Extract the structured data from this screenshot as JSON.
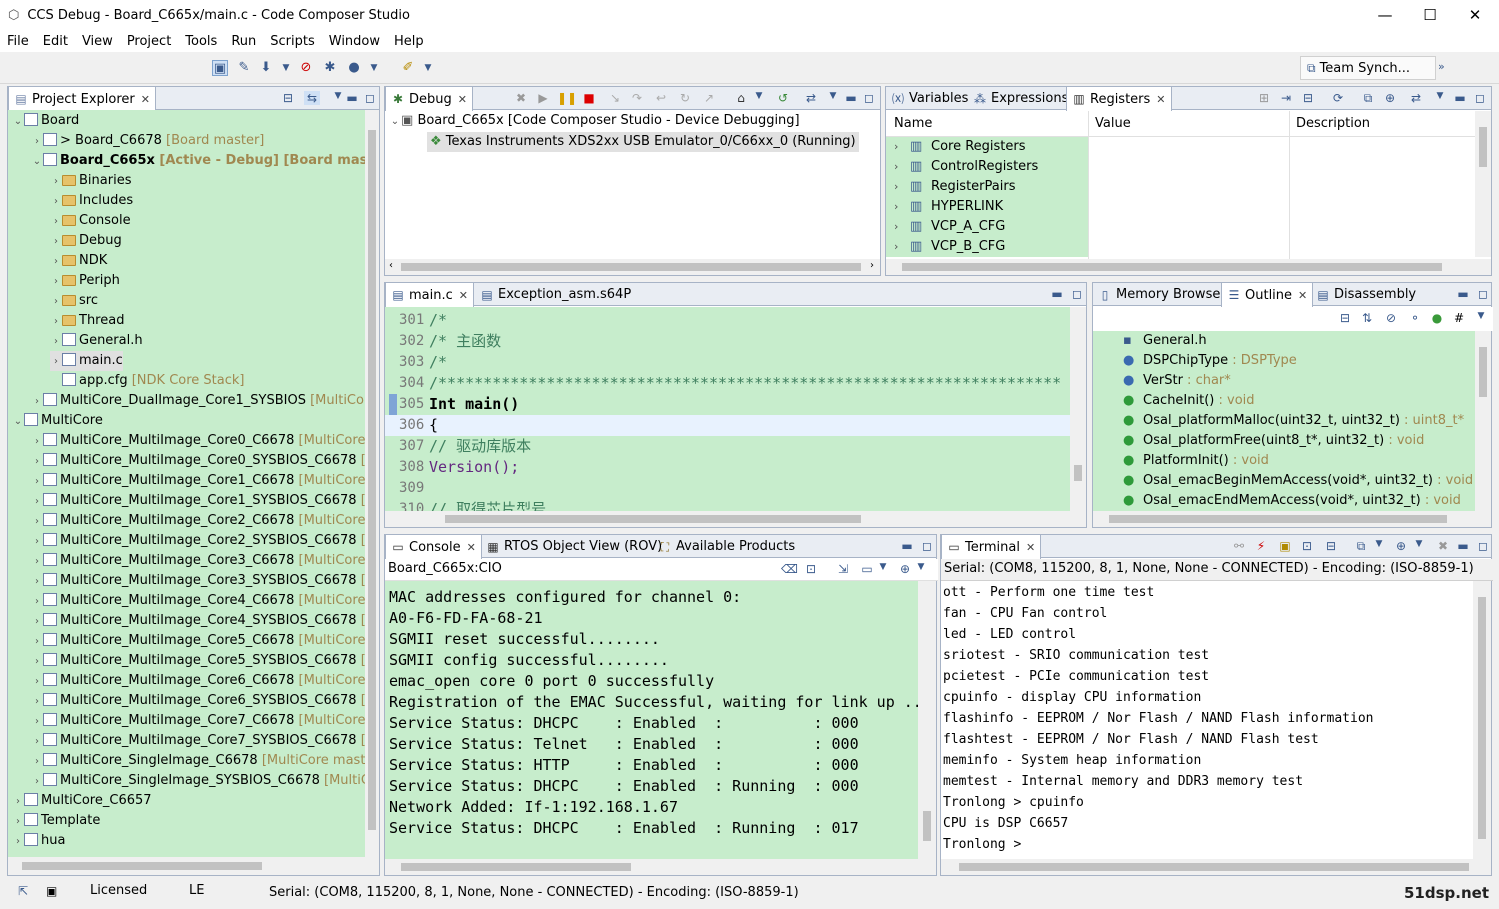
{
  "window": {
    "title": "CCS Debug - Board_C665x/main.c - Code Composer Studio"
  },
  "menu": [
    "File",
    "Edit",
    "View",
    "Project",
    "Tools",
    "Run",
    "Scripts",
    "Window",
    "Help"
  ],
  "team_sync": "Team Synch...",
  "project_explorer": {
    "tab": "Project Explorer",
    "items": [
      {
        "lvl": 0,
        "label": "Board",
        "exp": true
      },
      {
        "lvl": 1,
        "label": "> Board_C6678",
        "dec": " [Board master]",
        "exp": false
      },
      {
        "lvl": 1,
        "label": "Board_C665x",
        "dec": " [Active - Debug] [Board master]",
        "exp": true,
        "bold": true
      },
      {
        "lvl": 2,
        "label": "Binaries",
        "exp": false
      },
      {
        "lvl": 2,
        "label": "Includes",
        "exp": false
      },
      {
        "lvl": 2,
        "label": "Console",
        "exp": false
      },
      {
        "lvl": 2,
        "label": "Debug",
        "exp": false
      },
      {
        "lvl": 2,
        "label": "NDK",
        "exp": false
      },
      {
        "lvl": 2,
        "label": "Periph",
        "exp": false
      },
      {
        "lvl": 2,
        "label": "src",
        "exp": false
      },
      {
        "lvl": 2,
        "label": "Thread",
        "exp": false
      },
      {
        "lvl": 2,
        "label": "General.h",
        "exp": false
      },
      {
        "lvl": 2,
        "label": "main.c",
        "exp": false,
        "sel": true
      },
      {
        "lvl": 2,
        "label": "app.cfg",
        "dec": " [NDK Core Stack]",
        "leaf": true
      },
      {
        "lvl": 1,
        "label": "MultiCore_DualImage_Core1_SYSBIOS",
        "dec": " [MultiCore m",
        "exp": false
      },
      {
        "lvl": 0,
        "label": "MultiCore",
        "exp": true
      },
      {
        "lvl": 1,
        "label": "MultiCore_MultiImage_Core0_C6678",
        "dec": " [MultiCore ma",
        "exp": false
      },
      {
        "lvl": 1,
        "label": "MultiCore_MultiImage_Core0_SYSBIOS_C6678",
        "dec": " [Mu",
        "exp": false
      },
      {
        "lvl": 1,
        "label": "MultiCore_MultiImage_Core1_C6678",
        "dec": " [MultiCore ma",
        "exp": false
      },
      {
        "lvl": 1,
        "label": "MultiCore_MultiImage_Core1_SYSBIOS_C6678",
        "dec": " [Mu",
        "exp": false
      },
      {
        "lvl": 1,
        "label": "MultiCore_MultiImage_Core2_C6678",
        "dec": " [MultiCore ma",
        "exp": false
      },
      {
        "lvl": 1,
        "label": "MultiCore_MultiImage_Core2_SYSBIOS_C6678",
        "dec": " [Mu",
        "exp": false
      },
      {
        "lvl": 1,
        "label": "MultiCore_MultiImage_Core3_C6678",
        "dec": " [MultiCore ma",
        "exp": false
      },
      {
        "lvl": 1,
        "label": "MultiCore_MultiImage_Core3_SYSBIOS_C6678",
        "dec": " [Mu",
        "exp": false
      },
      {
        "lvl": 1,
        "label": "MultiCore_MultiImage_Core4_C6678",
        "dec": " [MultiCore ma",
        "exp": false
      },
      {
        "lvl": 1,
        "label": "MultiCore_MultiImage_Core4_SYSBIOS_C6678",
        "dec": " [Mu",
        "exp": false
      },
      {
        "lvl": 1,
        "label": "MultiCore_MultiImage_Core5_C6678",
        "dec": " [MultiCore ma",
        "exp": false
      },
      {
        "lvl": 1,
        "label": "MultiCore_MultiImage_Core5_SYSBIOS_C6678",
        "dec": " [Mu",
        "exp": false
      },
      {
        "lvl": 1,
        "label": "MultiCore_MultiImage_Core6_C6678",
        "dec": " [MultiCore ma",
        "exp": false
      },
      {
        "lvl": 1,
        "label": "MultiCore_MultiImage_Core6_SYSBIOS_C6678",
        "dec": " [Mu",
        "exp": false
      },
      {
        "lvl": 1,
        "label": "MultiCore_MultiImage_Core7_C6678",
        "dec": " [MultiCore ma",
        "exp": false
      },
      {
        "lvl": 1,
        "label": "MultiCore_MultiImage_Core7_SYSBIOS_C6678",
        "dec": " [Mu",
        "exp": false
      },
      {
        "lvl": 1,
        "label": "MultiCore_SingleImage_C6678",
        "dec": " [MultiCore master]",
        "exp": false
      },
      {
        "lvl": 1,
        "label": "MultiCore_SingleImage_SYSBIOS_C6678",
        "dec": " [MultiCore",
        "exp": false
      },
      {
        "lvl": 0,
        "label": "MultiCore_C6657",
        "exp": false
      },
      {
        "lvl": 0,
        "label": "Template",
        "exp": false
      },
      {
        "lvl": 0,
        "label": "hua",
        "exp": false
      }
    ]
  },
  "debug": {
    "tab": "Debug",
    "items": [
      "Board_C665x [Code Composer Studio - Device Debugging]",
      "Texas Instruments XDS2xx USB Emulator_0/C66xx_0 (Running)"
    ]
  },
  "registers": {
    "tabs": [
      "Variables",
      "Expressions",
      "Registers"
    ],
    "columns": [
      "Name",
      "Value",
      "Description"
    ],
    "rows": [
      "Core Registers",
      "ControlRegisters",
      "RegisterPairs",
      "HYPERLINK",
      "VCP_A_CFG",
      "VCP_B_CFG"
    ]
  },
  "editor": {
    "tabs": [
      "main.c",
      "Exception_asm.s64P"
    ],
    "lines": [
      {
        "n": "301",
        "t": "/*"
      },
      {
        "n": "302",
        "t": "/*             主函数"
      },
      {
        "n": "303",
        "t": "/*"
      },
      {
        "n": "304",
        "t": "/*********************************************************************"
      },
      {
        "n": "305",
        "t": "Int main()"
      },
      {
        "n": "306",
        "t": "{"
      },
      {
        "n": "307",
        "t": "    // 驱动库版本"
      },
      {
        "n": "308",
        "t": "    Version();"
      },
      {
        "n": "309",
        "t": ""
      },
      {
        "n": "310",
        "t": "    // 取得芯片型号"
      }
    ]
  },
  "outline": {
    "tabs": [
      "Memory Browser",
      "Outline",
      "Disassembly"
    ],
    "items": [
      {
        "name": "General.h",
        "type": ""
      },
      {
        "name": "DSPChipType",
        "type": " : DSPType"
      },
      {
        "name": "VerStr",
        "type": " : char*"
      },
      {
        "name": "CacheInit()",
        "type": " : void"
      },
      {
        "name": "Osal_platformMalloc(uint32_t, uint32_t)",
        "type": " : uint8_t*"
      },
      {
        "name": "Osal_platformFree(uint8_t*, uint32_t)",
        "type": " : void"
      },
      {
        "name": "PlatformInit()",
        "type": " : void"
      },
      {
        "name": "Osal_emacBeginMemAccess(void*, uint32_t)",
        "type": " : void"
      },
      {
        "name": "Osal_emacEndMemAccess(void*, uint32_t)",
        "type": " : void"
      }
    ]
  },
  "console": {
    "tabs": [
      "Console",
      "RTOS Object View (ROV)",
      "Available Products"
    ],
    "header": "Board_C665x:CIO",
    "lines": [
      "MAC addresses configured for channel 0:",
      "A0-F6-FD-FA-68-21",
      "SGMII reset successful........",
      "SGMII config successful........",
      "emac_open core 0 port 0 successfully",
      "Registration of the EMAC Successful, waiting for link up ..",
      "Service Status: DHCPC    : Enabled  :          : 000",
      "Service Status: Telnet   : Enabled  :          : 000",
      "Service Status: HTTP     : Enabled  :          : 000",
      "Service Status: DHCPC    : Enabled  : Running  : 000",
      "Network Added: If-1:192.168.1.67",
      "Service Status: DHCPC    : Enabled  : Running  : 017"
    ]
  },
  "terminal": {
    "tab": "Terminal",
    "header": "Serial: (COM8, 115200, 8, 1, None, None - CONNECTED) - Encoding: (ISO-8859-1)",
    "lines": [
      "ott - Perform one time test",
      "fan - CPU Fan control",
      "led - LED control",
      "sriotest - SRIO communication test",
      "pcietest - PCIe communication test",
      "cpuinfo - display CPU information",
      "flashinfo - EEPROM / Nor Flash / NAND Flash information",
      "flashtest - EEPROM / Nor Flash / NAND Flash test",
      "meminfo - System heap information",
      "memtest - Internal memory and DDR3 memory test",
      "Tronlong > cpuinfo",
      "CPU is DSP C6657",
      "Tronlong >"
    ]
  },
  "status": {
    "licensed": "Licensed",
    "le": "LE",
    "serial": "Serial: (COM8, 115200, 8, 1, None, None - CONNECTED) - Encoding: (ISO-8859-1)",
    "watermark": "51dsp.net"
  }
}
